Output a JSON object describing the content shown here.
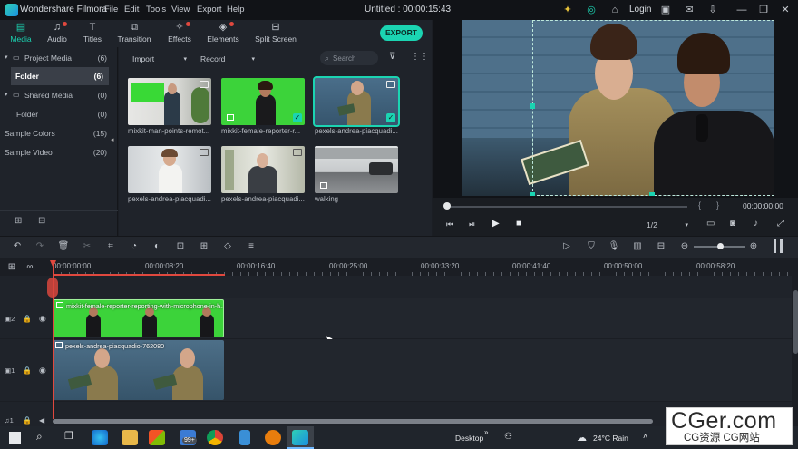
{
  "titlebar": {
    "app_name": "Wondershare Filmora",
    "menus": [
      "File",
      "Edit",
      "Tools",
      "View",
      "Export",
      "Help"
    ],
    "document_title": "Untitled : 00:00:15:43",
    "login_label": "Login"
  },
  "tabs": [
    {
      "label": "Media",
      "icon": "media-icon",
      "active": true,
      "badge": false
    },
    {
      "label": "Audio",
      "icon": "music-note-icon",
      "active": false,
      "badge": true
    },
    {
      "label": "Titles",
      "icon": "text-icon",
      "active": false,
      "badge": false
    },
    {
      "label": "Transition",
      "icon": "transition-icon",
      "active": false,
      "badge": false
    },
    {
      "label": "Effects",
      "icon": "effects-icon",
      "active": false,
      "badge": true
    },
    {
      "label": "Elements",
      "icon": "elements-icon",
      "active": false,
      "badge": true
    },
    {
      "label": "Split Screen",
      "icon": "split-screen-icon",
      "active": false,
      "badge": false
    }
  ],
  "export_label": "EXPORT",
  "left_panel": {
    "items": [
      {
        "name": "Project Media",
        "count": "(6)",
        "caret": "▾",
        "folder": true
      },
      {
        "name": "Folder",
        "count": "(6)",
        "selected": true
      },
      {
        "name": "Shared Media",
        "count": "(0)",
        "caret": "▾",
        "folder": true
      },
      {
        "name": "Folder",
        "count": "(0)"
      },
      {
        "name": "Sample Colors",
        "count": "(15)"
      },
      {
        "name": "Sample Video",
        "count": "(20)"
      }
    ]
  },
  "media_toolbar": {
    "import_label": "Import",
    "record_label": "Record",
    "search_placeholder": "Search"
  },
  "media_items": [
    {
      "label": "mixkit-man-points-remot...",
      "selected": false,
      "checked": false
    },
    {
      "label": "mixkit-female-reporter-r...",
      "selected": false,
      "checked": true
    },
    {
      "label": "pexels-andrea-piacquadi...",
      "selected": true,
      "checked": true
    },
    {
      "label": "pexels-andrea-piacquadi...",
      "selected": false,
      "checked": false
    },
    {
      "label": "pexels-andrea-piacquadi...",
      "selected": false,
      "checked": false
    },
    {
      "label": "walking",
      "selected": false,
      "checked": false
    }
  ],
  "preview": {
    "timecode": "00:00:00:00",
    "quality": "1/2"
  },
  "ruler": {
    "labels": [
      "00:00:00:00",
      "00:00:08:20",
      "00:00:16:40",
      "00:00:25:00",
      "00:00:33:20",
      "00:00:41:40",
      "00:00:50:00",
      "00:00:58:20"
    ]
  },
  "tracks": {
    "track2_clip_label": "mixkit-female-reporter-reporting-with-microphone-in-h...",
    "track1_clip_label": "pexels-andrea-piacquadio-762080"
  },
  "taskbar": {
    "desktop_label": "Desktop",
    "weather": "24°C  Rain",
    "badge": "99+"
  },
  "watermark": {
    "main": "CGer.com",
    "sub": "CG资源 CG网站"
  },
  "colors": {
    "accent": "#1bd4b2",
    "playhead": "#e0483e",
    "green_screen": "#3cd33a"
  }
}
